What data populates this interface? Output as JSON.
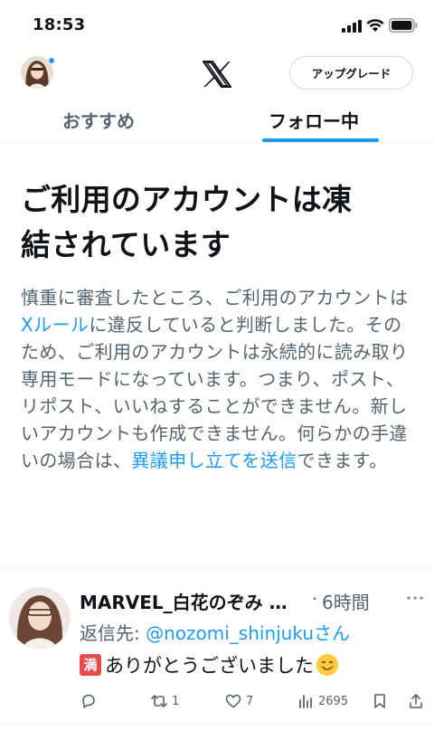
{
  "status_bar": {
    "time": "18:53"
  },
  "header": {
    "logo": "x-logo",
    "upgrade_label": "アップグレード"
  },
  "tabs": [
    {
      "label": "おすすめ",
      "active": false
    },
    {
      "label": "フォロー中",
      "active": true
    }
  ],
  "notice": {
    "title_line1": "ご利用のアカウントは凍",
    "title_line2": "結されています",
    "body_part1": "慎重に審査したところ、ご利用のアカウントは",
    "body_link1": "Xルール",
    "body_part2": "に違反していると判断しました。そのため、ご利用のアカウントは永続的に読み取り専用モードになっています。つまり、ポスト、リポスト、いいねすることができません。新しいアカウントも作成できません。何らかの手違いの場合は、",
    "body_link2": "異議申し立てを送信",
    "body_part3": "できます。"
  },
  "tweet": {
    "author": "MARVEL_白花のぞみ …",
    "dot": "·",
    "time": "6時間",
    "reply_prefix": "返信先: ",
    "reply_handle": "@nozomi_shinjuku",
    "reply_suffix": "さん",
    "emoji_badge": "満",
    "text": "ありがとうございました",
    "retweets": "1",
    "likes": "7",
    "views": "2695"
  },
  "colors": {
    "accent": "#1d9bf0",
    "text_primary": "#0f1419",
    "text_secondary": "#536471",
    "divider": "#eff3f4"
  }
}
